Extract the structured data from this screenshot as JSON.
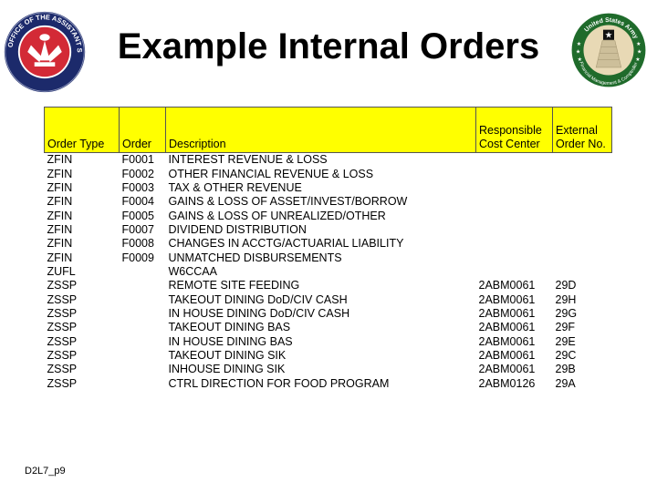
{
  "page": {
    "title": "Example Internal Orders",
    "footer_label": "D2L7_p9",
    "logos": {
      "left": "office-of-the-assistant-secretary-of-the-army-seal",
      "left_text": "OFFICE OF THE ASSISTANT SECRETARY OF THE ARMY",
      "right": "united-states-army-seal",
      "right_text_top": "United States Army",
      "right_text_bottom": "Financial Management & Comptroller"
    }
  },
  "colors": {
    "header_fill": "#ffff00",
    "border": "#555555",
    "seal_left_outer": "#1c2a6b",
    "seal_left_inner": "#d32a36",
    "seal_right_ring": "#1f6b2b",
    "seal_right_inner": "#e8d9b5"
  },
  "table": {
    "headers": {
      "order_type": "Order Type",
      "order": "Order",
      "description": "Description",
      "cost_center_line1": "Responsible",
      "cost_center_line2": "Cost Center",
      "external_line1": "External",
      "external_line2": "Order No."
    },
    "rows": [
      {
        "order_type": "ZFIN",
        "order": "F0001",
        "description": "INTEREST REVENUE & LOSS",
        "cost_center": "",
        "external": ""
      },
      {
        "order_type": "ZFIN",
        "order": "F0002",
        "description": "OTHER FINANCIAL REVENUE & LOSS",
        "cost_center": "",
        "external": ""
      },
      {
        "order_type": "ZFIN",
        "order": "F0003",
        "description": "TAX & OTHER REVENUE",
        "cost_center": "",
        "external": ""
      },
      {
        "order_type": "ZFIN",
        "order": "F0004",
        "description": "GAINS & LOSS OF ASSET/INVEST/BORROW",
        "cost_center": "",
        "external": ""
      },
      {
        "order_type": "ZFIN",
        "order": "F0005",
        "description": "GAINS & LOSS OF UNREALIZED/OTHER",
        "cost_center": "",
        "external": ""
      },
      {
        "order_type": "ZFIN",
        "order": "F0007",
        "description": "DIVIDEND DISTRIBUTION",
        "cost_center": "",
        "external": ""
      },
      {
        "order_type": "ZFIN",
        "order": "F0008",
        "description": "CHANGES IN ACCTG/ACTUARIAL LIABILITY",
        "cost_center": "",
        "external": ""
      },
      {
        "order_type": "ZFIN",
        "order": "F0009",
        "description": "UNMATCHED DISBURSEMENTS",
        "cost_center": "",
        "external": ""
      },
      {
        "order_type": "ZUFL",
        "order": "",
        "description": "W6CCAA",
        "cost_center": "",
        "external": ""
      },
      {
        "order_type": "ZSSP",
        "order": "",
        "description": "REMOTE SITE FEEDING",
        "cost_center": "2ABM0061",
        "external": "29D"
      },
      {
        "order_type": "ZSSP",
        "order": "",
        "description": "TAKEOUT DINING DoD/CIV CASH",
        "cost_center": "2ABM0061",
        "external": "29H"
      },
      {
        "order_type": "ZSSP",
        "order": "",
        "description": "IN HOUSE DINING DoD/CIV CASH",
        "cost_center": "2ABM0061",
        "external": "29G"
      },
      {
        "order_type": "ZSSP",
        "order": "",
        "description": "TAKEOUT DINING BAS",
        "cost_center": "2ABM0061",
        "external": "29F"
      },
      {
        "order_type": "ZSSP",
        "order": "",
        "description": "IN HOUSE DINING BAS",
        "cost_center": "2ABM0061",
        "external": "29E"
      },
      {
        "order_type": "ZSSP",
        "order": "",
        "description": "TAKEOUT DINING SIK",
        "cost_center": "2ABM0061",
        "external": "29C"
      },
      {
        "order_type": "ZSSP",
        "order": "",
        "description": "INHOUSE DINING SIK",
        "cost_center": "2ABM0061",
        "external": "29B"
      },
      {
        "order_type": "ZSSP",
        "order": "",
        "description": "CTRL DIRECTION FOR FOOD PROGRAM",
        "cost_center": "2ABM0126",
        "external": "29A"
      }
    ]
  }
}
